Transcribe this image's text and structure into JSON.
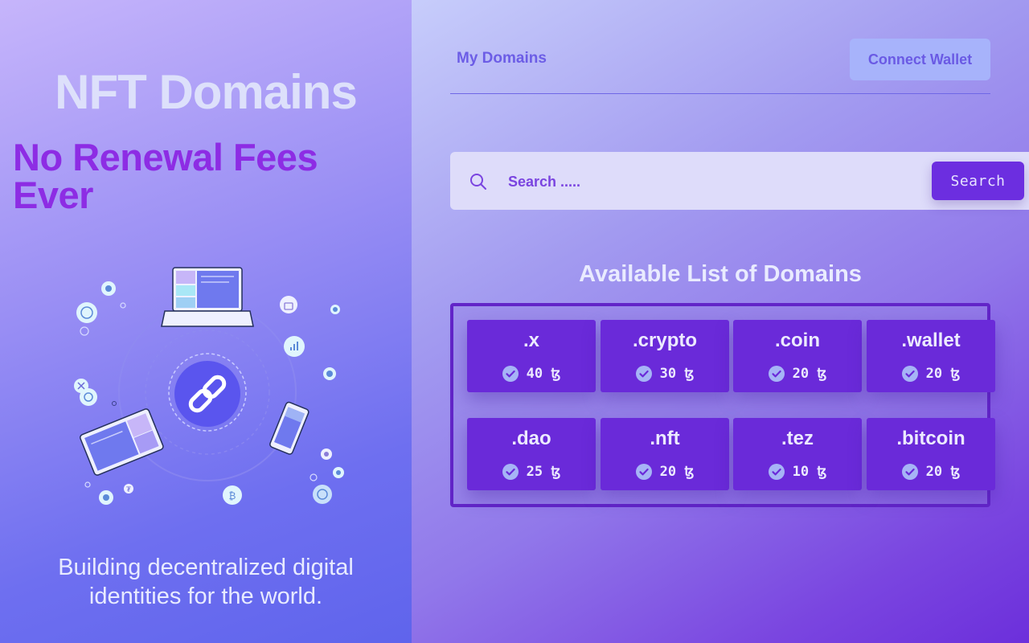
{
  "hero": {
    "title": "NFT Domains",
    "tagline": "No Renewal Fees Ever",
    "subtitle": "Building decentralized digital identities for the world."
  },
  "nav": {
    "my_domains": "My Domains",
    "connect_wallet": "Connect Wallet"
  },
  "search": {
    "placeholder": "Search .....",
    "button": "Search"
  },
  "list": {
    "title": "Available List of Domains",
    "currency_symbol": "ꜩ",
    "domains": [
      {
        "name": ".x",
        "price": "40"
      },
      {
        "name": ".crypto",
        "price": "30"
      },
      {
        "name": ".coin",
        "price": "20"
      },
      {
        "name": ".wallet",
        "price": "20"
      },
      {
        "name": ".dao",
        "price": "25"
      },
      {
        "name": ".nft",
        "price": "20"
      },
      {
        "name": ".tez",
        "price": "10"
      },
      {
        "name": ".bitcoin",
        "price": "20"
      }
    ]
  },
  "colors": {
    "accent": "#6c2ee0",
    "tagline": "#8d2ce4",
    "card": "#6a2ad9"
  },
  "icons": [
    "search-icon",
    "check-circle-icon",
    "link-icon",
    "laptop-icon",
    "tablet-icon",
    "phone-icon"
  ]
}
